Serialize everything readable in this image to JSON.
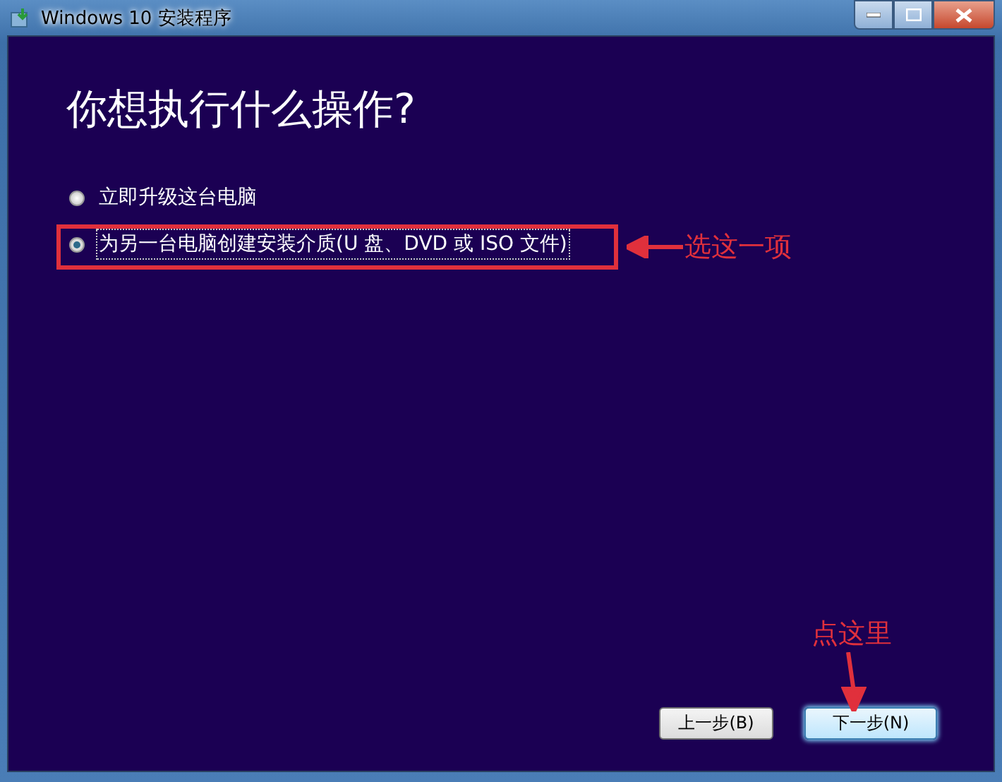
{
  "window": {
    "title": "Windows 10 安装程序"
  },
  "heading": "你想执行什么操作?",
  "options": [
    {
      "label": "立即升级这台电脑",
      "selected": false
    },
    {
      "label": "为另一台电脑创建安装介质(U 盘、DVD 或 ISO 文件)",
      "selected": true
    }
  ],
  "buttons": [
    {
      "label": "上一步(B)",
      "default": false
    },
    {
      "label": "下一步(N)",
      "default": true
    }
  ],
  "annotations": [
    {
      "kind": "box-arrow",
      "text": "选这一项"
    },
    {
      "kind": "down-arrow",
      "text": "点这里"
    }
  ]
}
